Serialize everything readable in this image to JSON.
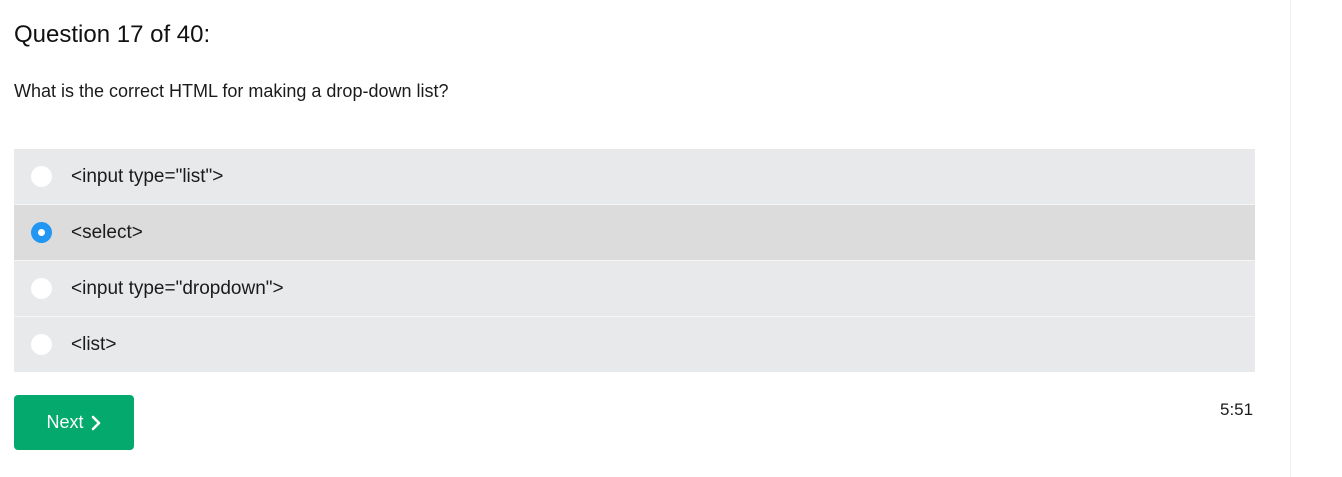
{
  "quiz": {
    "heading": "Question 17 of 40:",
    "question": "What is the correct HTML for making a drop-down list?",
    "options": [
      {
        "label": "<input type=\"list\">",
        "selected": false
      },
      {
        "label": "<select>",
        "selected": true
      },
      {
        "label": "<input type=\"dropdown\">",
        "selected": false
      },
      {
        "label": "<list>",
        "selected": false
      }
    ],
    "next_label": "Next",
    "next_icon": "chevron-right-icon",
    "timer": "5:51"
  },
  "colors": {
    "option_bg": "#e8e9ea",
    "option_selected_bg": "#dcdcdc",
    "radio_selected": "#2196f3",
    "next_button": "#04aa6d"
  }
}
